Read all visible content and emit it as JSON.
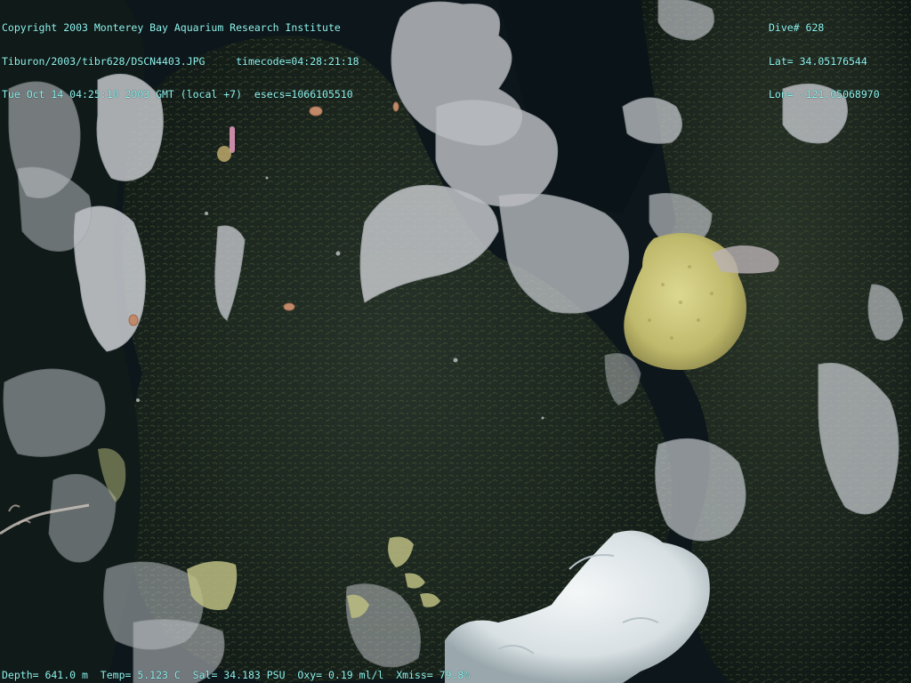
{
  "header_left": {
    "copyright": "Copyright 2003 Monterey Bay Aquarium Research Institute",
    "file_path": "Tiburon/2003/tibr628/DSCN4403.JPG",
    "timecode": "timecode=04:28:21:18",
    "datetime": "Tue Oct 14 04:25:10 2003 GMT (local +7)",
    "esecs": "esecs=1066105510"
  },
  "header_right": {
    "dive": "Dive# 628",
    "lat": "Lat= 34.05176544",
    "lon": "Lon= -121.05068970"
  },
  "footer": {
    "depth": "Depth= 641.0 m",
    "temp": "Temp= 5.123 C",
    "sal": "Sal= 34.183 PSU",
    "oxy": "Oxy= 0.19 ml/l",
    "xmiss": "Xmiss= 79.8%"
  },
  "colors": {
    "overlay_text": "#8ff5f0",
    "rock": "#1a2620",
    "algae": "#4f5a35",
    "gorgonian": "#c9ccd0",
    "yellow_sponge": "#c8c27a",
    "white_sponge": "#e6ecef"
  }
}
